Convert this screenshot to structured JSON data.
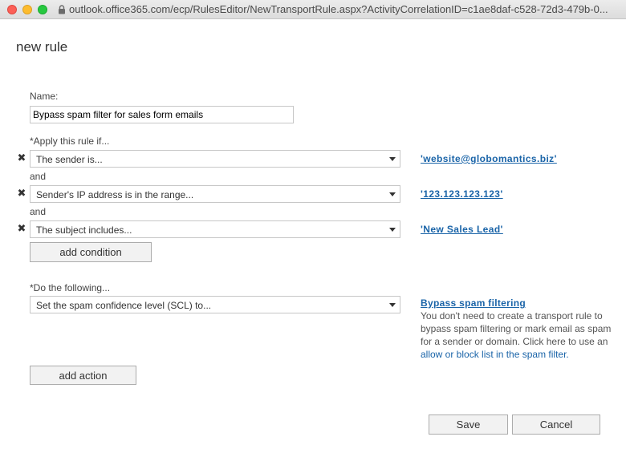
{
  "browser": {
    "url": "outlook.office365.com/ecp/RulesEditor/NewTransportRule.aspx?ActivityCorrelationID=c1ae8daf-c528-72d3-479b-0..."
  },
  "page": {
    "title": "new rule"
  },
  "form": {
    "name_label": "Name:",
    "name_value": "Bypass spam filter for sales form emails",
    "apply_label": "*Apply this rule if...",
    "and_label": "and",
    "conditions": [
      {
        "selected": "The sender is...",
        "value": "'website@globomantics.biz'"
      },
      {
        "selected": "Sender's IP address is in the range...",
        "value": "'123.123.123.123'"
      },
      {
        "selected": "The subject includes...",
        "value": "'New Sales Lead'"
      }
    ],
    "add_condition_label": "add condition",
    "do_label": "*Do the following...",
    "action": {
      "selected": "Set the spam confidence level (SCL) to..."
    },
    "add_action_label": "add action"
  },
  "help": {
    "title": "Bypass spam filtering",
    "text": "You don't need to create a transport rule to bypass spam filtering or mark email as spam for a sender or domain. Click here to use an",
    "link": "allow or block list in the spam filter."
  },
  "footer": {
    "save_label": "Save",
    "cancel_label": "Cancel"
  },
  "colors": {
    "link": "#1a64a8",
    "close": "#fc5f57",
    "minimize": "#fdbc2e",
    "maximize": "#27c840"
  },
  "icons": [
    "close-icon",
    "minimize-icon",
    "maximize-icon",
    "lock-icon",
    "remove-condition-icon",
    "dropdown-caret-icon"
  ]
}
